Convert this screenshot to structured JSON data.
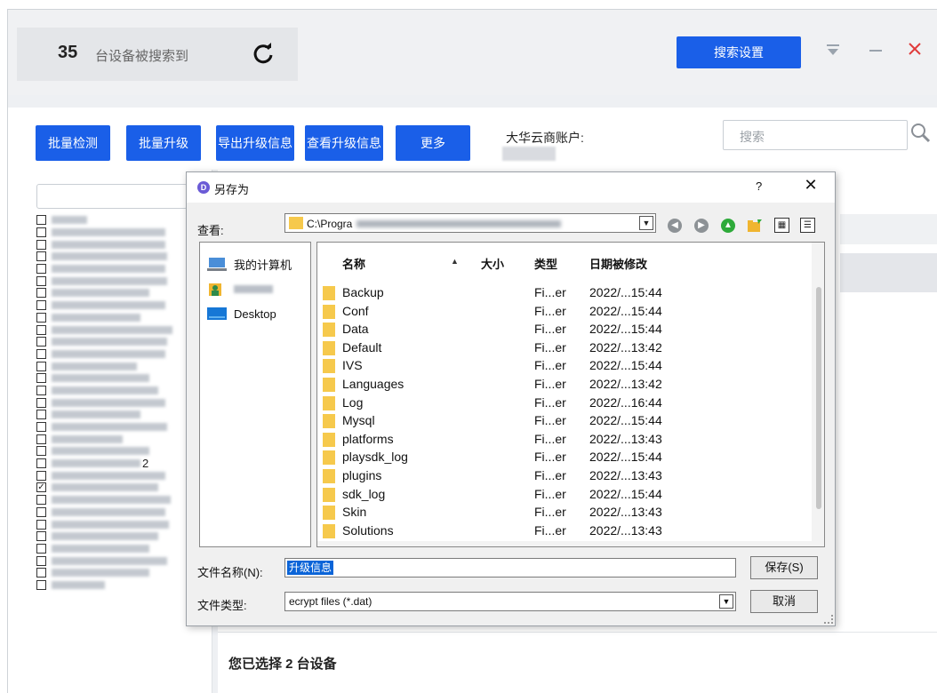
{
  "header": {
    "device_count": "35",
    "device_count_text": "台设备被搜索到",
    "search_settings_label": "搜索设置",
    "colors": {
      "accent": "#1a5fe8",
      "close": "#e03b3b"
    }
  },
  "toolbar": {
    "batch_detect": "批量检测",
    "batch_upgrade": "批量升级",
    "export_upgrade_info": "导出升级信息",
    "view_upgrade_info": "查看升级信息",
    "more": "更多",
    "account_label": "大华云商账户:",
    "search_placeholder": "搜索"
  },
  "device_list": {
    "checked_states": [
      false,
      false,
      false,
      false,
      false,
      false,
      false,
      false,
      false,
      false,
      false,
      false,
      false,
      false,
      false,
      false,
      false,
      false,
      false,
      false,
      false,
      false,
      true,
      false,
      false,
      false,
      false,
      false,
      false,
      false,
      false
    ],
    "trailing_char_row_21": "2"
  },
  "selection": {
    "summary": "您已选择 2 台设备"
  },
  "dialog": {
    "title": "另存为",
    "help": "?",
    "close": "✕",
    "look_in_label": "查看:",
    "path_prefix": "C:\\Progra",
    "places": [
      {
        "label": "我的计算机",
        "icon": "computer-icon"
      },
      {
        "label": "",
        "icon": "user-icon"
      },
      {
        "label": "Desktop",
        "icon": "desktop-icon"
      }
    ],
    "columns": {
      "name": "名称",
      "size": "大小",
      "type": "类型",
      "modified": "日期被修改"
    },
    "files": [
      {
        "name": "Backup",
        "type": "Fi...er",
        "date": "2022/...15:44"
      },
      {
        "name": "Conf",
        "type": "Fi...er",
        "date": "2022/...15:44"
      },
      {
        "name": "Data",
        "type": "Fi...er",
        "date": "2022/...15:44"
      },
      {
        "name": "Default",
        "type": "Fi...er",
        "date": "2022/...13:42"
      },
      {
        "name": "IVS",
        "type": "Fi...er",
        "date": "2022/...15:44"
      },
      {
        "name": "Languages",
        "type": "Fi...er",
        "date": "2022/...13:42"
      },
      {
        "name": "Log",
        "type": "Fi...er",
        "date": "2022/...16:44"
      },
      {
        "name": "Mysql",
        "type": "Fi...er",
        "date": "2022/...15:44"
      },
      {
        "name": "platforms",
        "type": "Fi...er",
        "date": "2022/...13:43"
      },
      {
        "name": "playsdk_log",
        "type": "Fi...er",
        "date": "2022/...15:44"
      },
      {
        "name": "plugins",
        "type": "Fi...er",
        "date": "2022/...13:43"
      },
      {
        "name": "sdk_log",
        "type": "Fi...er",
        "date": "2022/...15:44"
      },
      {
        "name": "Skin",
        "type": "Fi...er",
        "date": "2022/...13:43"
      },
      {
        "name": "Solutions",
        "type": "Fi...er",
        "date": "2022/...13:43"
      }
    ],
    "filename_label": "文件名称(N):",
    "filename_value": "升级信息",
    "filetype_label": "文件类型:",
    "filetype_value": "ecrypt files (*.dat)",
    "save_label": "保存(S)",
    "cancel_label": "取消"
  }
}
